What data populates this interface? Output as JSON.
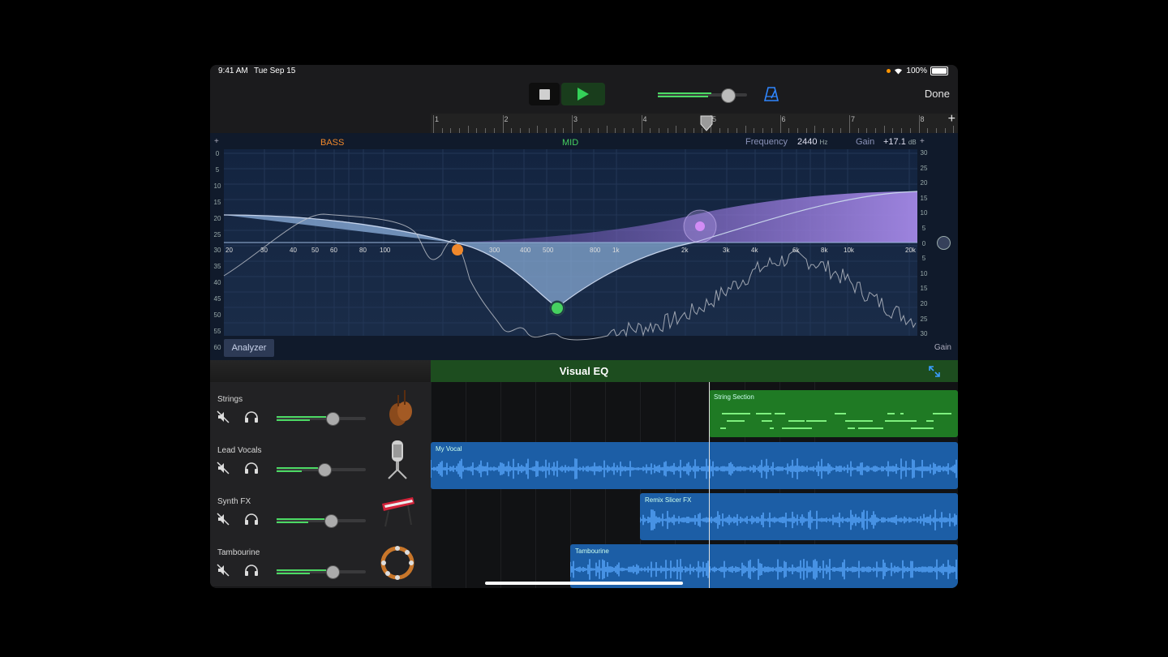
{
  "status_bar": {
    "time": "9:41 AM",
    "date": "Tue Sep 15",
    "battery": "100%"
  },
  "toolbar": {
    "done_label": "Done",
    "stop_icon": "stop-icon",
    "play_icon": "play-icon",
    "metronome_icon": "metronome-icon"
  },
  "ruler": {
    "bars": [
      "1",
      "2",
      "3",
      "4",
      "5",
      "6",
      "7",
      "8"
    ],
    "add_label": "+"
  },
  "eq": {
    "band_bass": "BASS",
    "band_mid": "MID",
    "frequency_label": "Frequency",
    "frequency_value": "2440",
    "frequency_unit": "Hz",
    "gain_label": "Gain",
    "gain_value": "+17.1",
    "gain_unit": "dB",
    "plus_left": "+",
    "plus_right": "+",
    "left_scale": [
      "0",
      "5",
      "10",
      "15",
      "20",
      "25",
      "30",
      "35",
      "40",
      "45",
      "50",
      "55",
      "60"
    ],
    "right_scale": [
      "30",
      "25",
      "20",
      "15",
      "10",
      "5",
      "0",
      "5",
      "10",
      "15",
      "20",
      "25",
      "30"
    ],
    "freq_labels": [
      "20",
      "30",
      "40",
      "50",
      "60",
      "80",
      "100",
      "300",
      "400",
      "500",
      "800",
      "1k",
      "2k",
      "3k",
      "4k",
      "6k",
      "8k",
      "10k",
      "20k"
    ],
    "analyzer_label": "Analyzer",
    "gain_footer": "Gain",
    "colors": {
      "bass": "#f0882b",
      "mid": "#46d160",
      "high": "#c08cf0"
    }
  },
  "visual_eq": {
    "title": "Visual EQ",
    "expand_icon": "expand-icon"
  },
  "tracks": [
    {
      "name": "Strings",
      "instrument_icon": "strings-icon",
      "volume": 0.62,
      "region": "String Section",
      "color": "#1f7a24"
    },
    {
      "name": "Lead Vocals",
      "instrument_icon": "microphone-icon",
      "volume": 0.53,
      "region": "My Vocal",
      "color": "#1c5ea6"
    },
    {
      "name": "Synth FX",
      "instrument_icon": "keyboard-icon",
      "volume": 0.6,
      "region": "Remix Slicer FX",
      "color": "#1c5ea6"
    },
    {
      "name": "Tambourine",
      "instrument_icon": "tambourine-icon",
      "volume": 0.62,
      "region": "Tambourine",
      "color": "#1c5ea6"
    }
  ]
}
